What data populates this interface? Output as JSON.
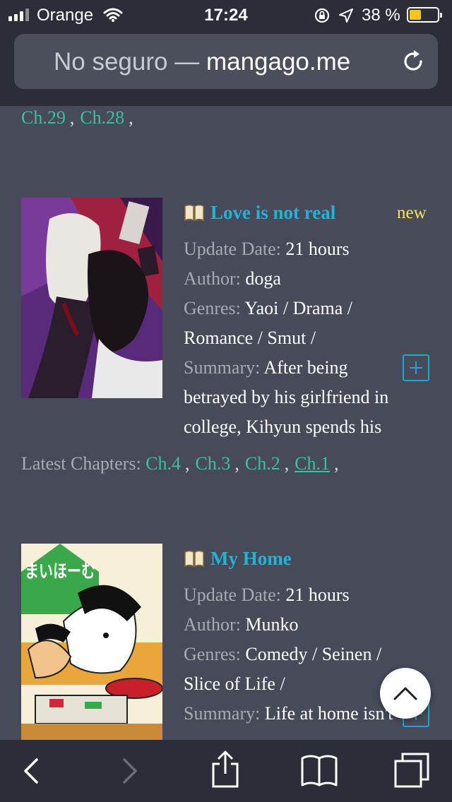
{
  "status_bar": {
    "carrier": "Orange",
    "time": "17:24",
    "battery_percent": "38 %",
    "battery_level": 0.38
  },
  "url_bar": {
    "insecure_label": "No seguro —",
    "domain": "mangago.me",
    "reload_icon": "reload-icon"
  },
  "previous_entry": {
    "chapters": [
      "Ch.29",
      "Ch.28"
    ],
    "separator": ","
  },
  "entries": [
    {
      "title": "Love is not real",
      "badge": "new",
      "update_label": "Update Date:",
      "update_value": "21 hours",
      "author_label": "Author:",
      "author_value": "doga",
      "genres_label": "Genres:",
      "genres_line1": "Yaoi / Drama /",
      "genres_line2": "Romance / Smut /",
      "summary_label": "Summary:",
      "summary_line1": "After being",
      "summary_line2": "betrayed by his girlfriend in",
      "summary_line3": "college, Kihyun spends his",
      "latest_label": "Latest Chapters:",
      "chapters": [
        "Ch.4",
        "Ch.3",
        "Ch.2",
        "Ch.1"
      ]
    },
    {
      "title": "My Home",
      "update_label": "Update Date:",
      "update_value": "21 hours",
      "author_label": "Author:",
      "author_value": "Munko",
      "genres_label": "Genres:",
      "genres_line1": "Comedy / Seinen /",
      "genres_line2": "Slice of Life /",
      "summary_label": "Summary:",
      "summary_line1": "Life at home isn't",
      "cover_text": "まいほーむ"
    }
  ],
  "colors": {
    "background": "#464a59",
    "chrome": "#2b2e38",
    "chapter_link": "#3fbf9c",
    "title": "#22b3d6",
    "new_badge": "#f4e45a",
    "label": "#a9abb3"
  }
}
